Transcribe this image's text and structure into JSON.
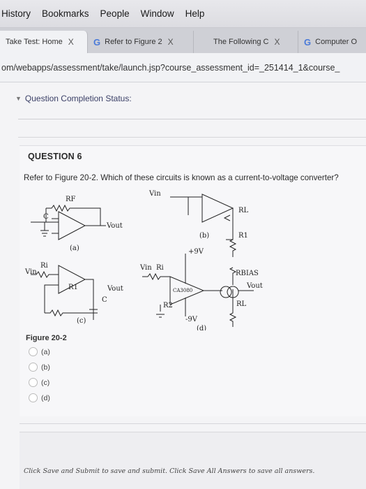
{
  "menubar": {
    "items": [
      "History",
      "Bookmarks",
      "People",
      "Window",
      "Help"
    ]
  },
  "tabs": [
    {
      "label": "Take Test: Home",
      "close": "X",
      "active": true
    },
    {
      "label": "Refer to Figure 2",
      "close": "X",
      "active": false
    },
    {
      "label": "The Following C",
      "close": "X",
      "active": false
    },
    {
      "label": "Computer O",
      "close": "",
      "active": false
    }
  ],
  "url": "om/webapps/assessment/take/launch.jsp?course_assessment_id=_251414_1&course_",
  "status": {
    "label": "Question Completion Status:"
  },
  "question": {
    "title": "QUESTION 6",
    "text": "Refer to Figure 20-2. Which of these circuits is known as a current-to-voltage converter?",
    "figure_caption": "Figure 20-2",
    "options": [
      "(a)",
      "(b)",
      "(c)",
      "(d)"
    ]
  },
  "figure": {
    "label_a": "(a)",
    "label_b": "(b)",
    "label_c": "(c)",
    "label_d": "(d)",
    "rf": "RF",
    "c": "C",
    "vout": "Vout",
    "vin": "Vin",
    "ri": "Ri",
    "rl": "RL",
    "r1": "R1",
    "plus9": "+9V",
    "minus9": "-9V",
    "rbias": "RBIAS",
    "ca3080": "CA3080",
    "r2": "R2"
  },
  "footer": {
    "text": "Click Save and Submit to save and submit. Click Save All Answers to save all answers."
  }
}
